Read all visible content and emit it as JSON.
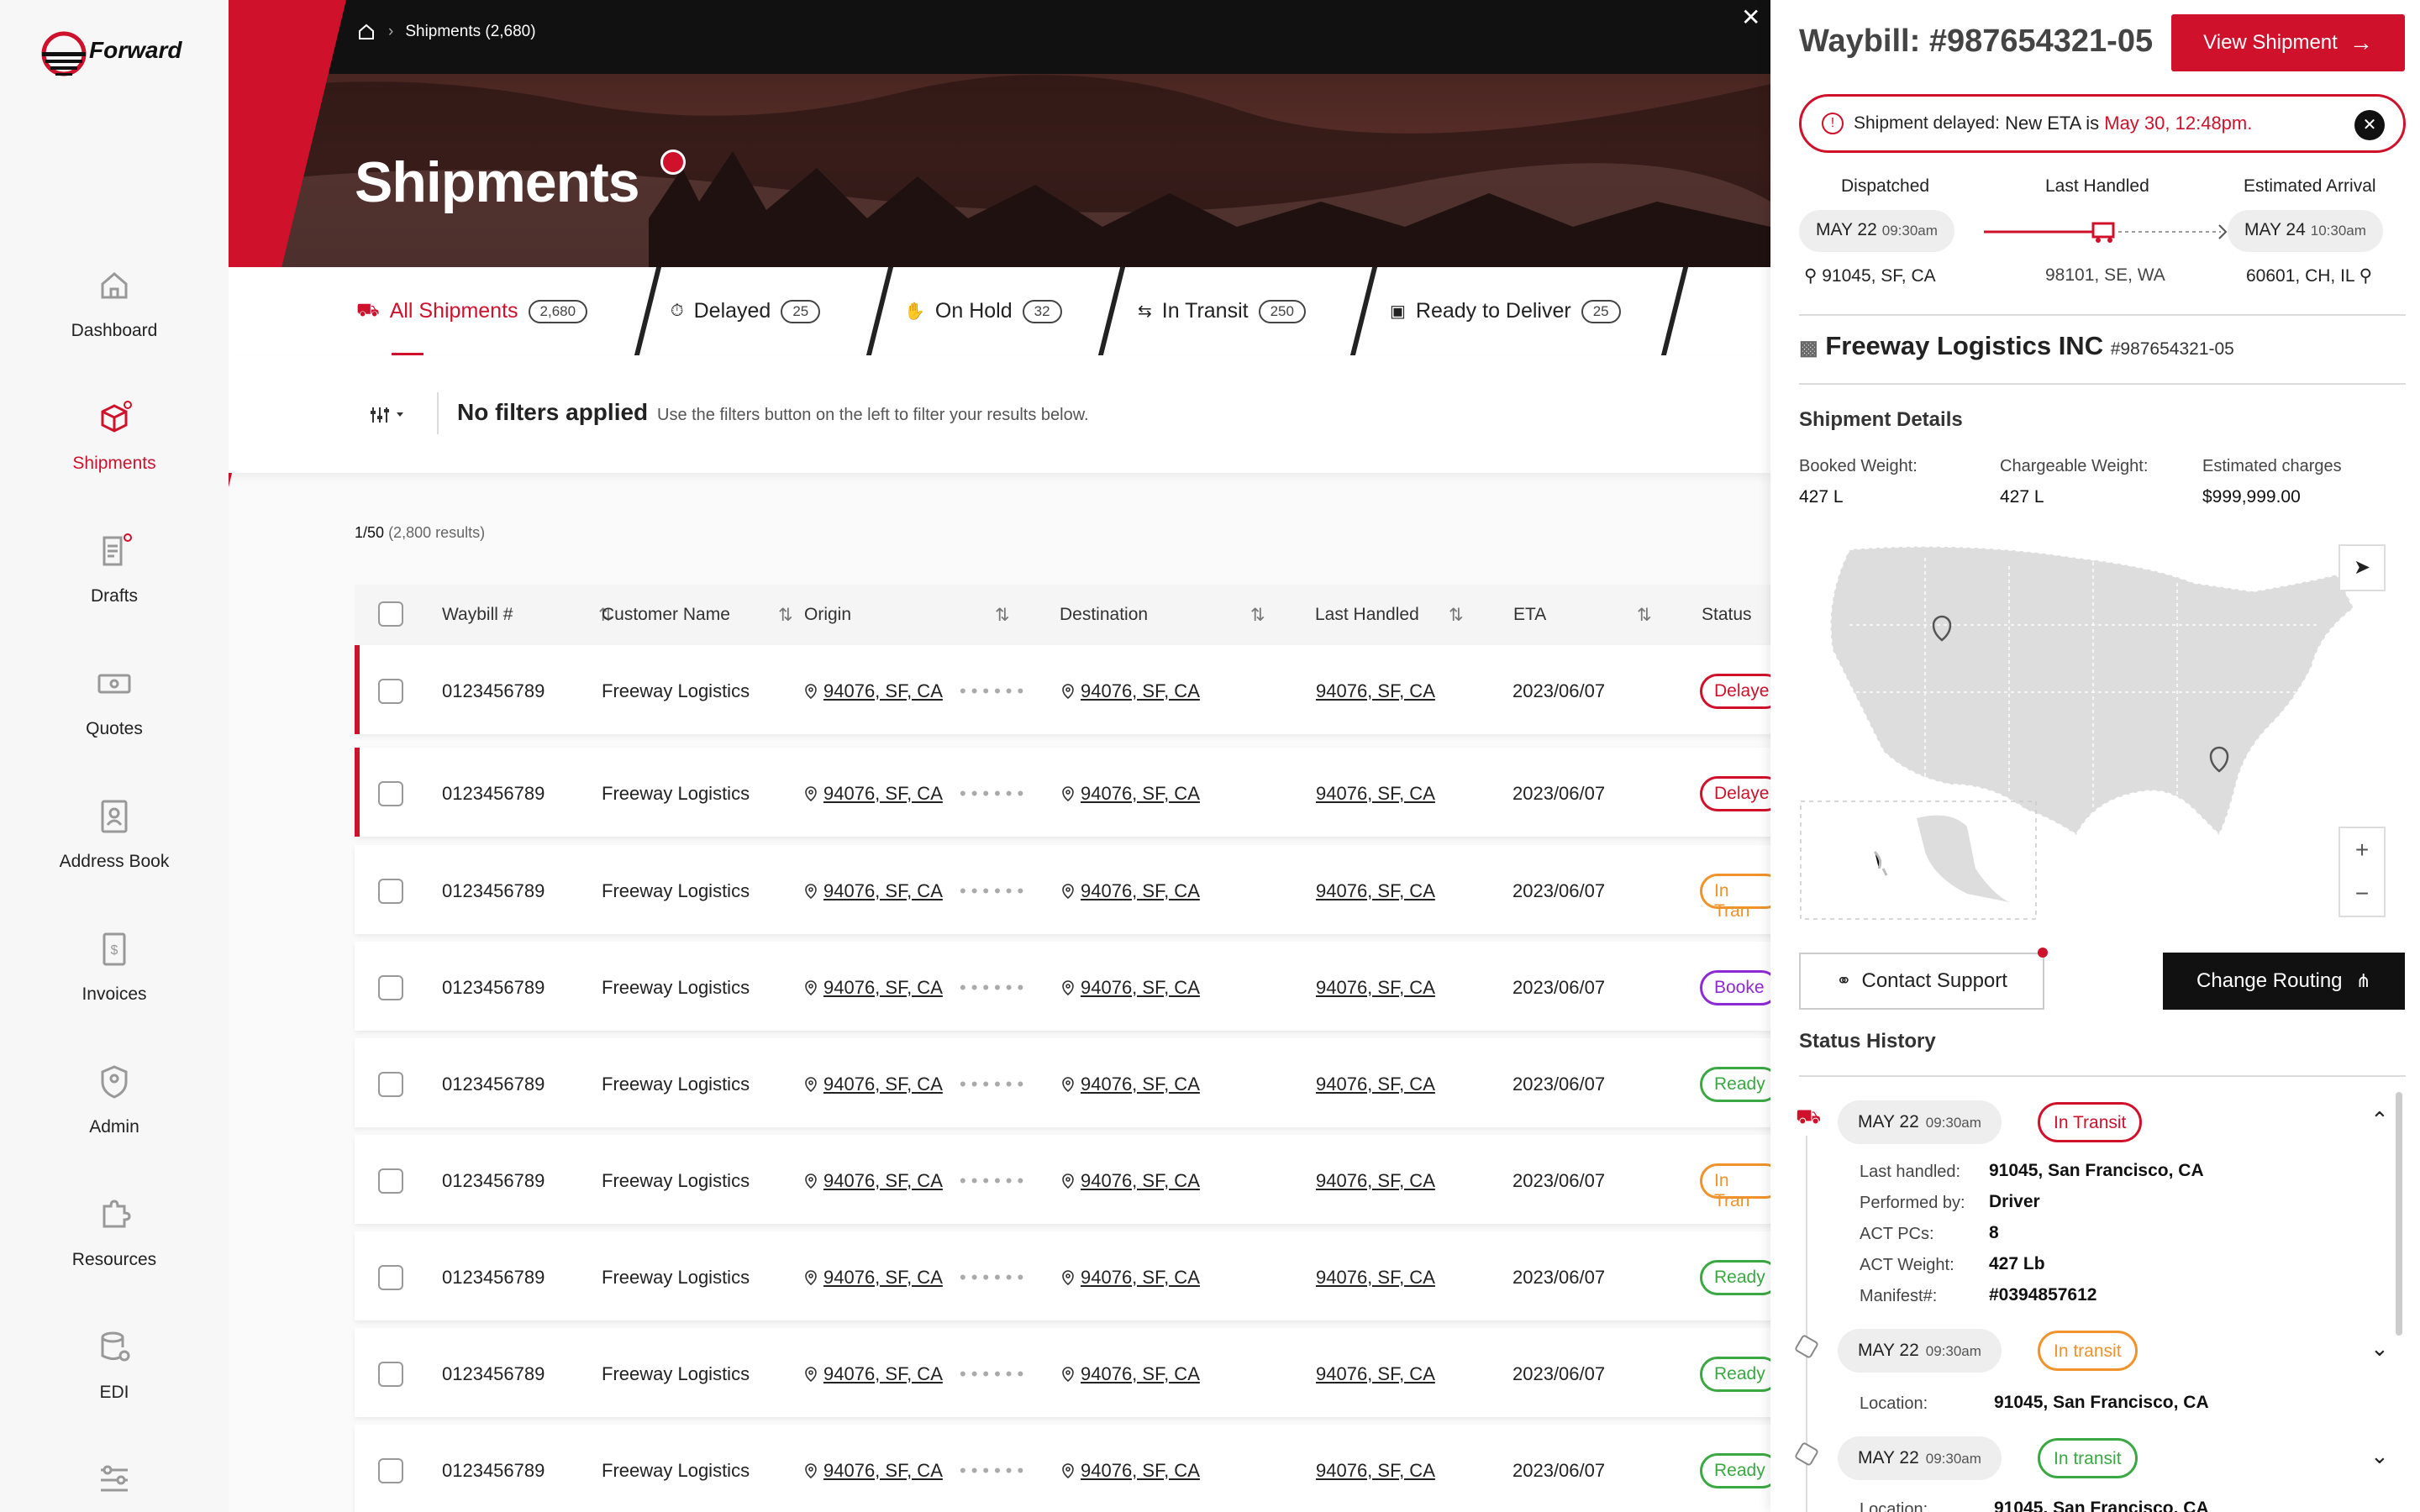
{
  "app": {
    "brand": "Forward"
  },
  "sidebar": {
    "items": [
      {
        "label": "Dashboard",
        "icon": "home-icon"
      },
      {
        "label": "Shipments",
        "icon": "box-icon",
        "active": true
      },
      {
        "label": "Drafts",
        "icon": "drafts-icon"
      },
      {
        "label": "Quotes",
        "icon": "money-icon"
      },
      {
        "label": "Address Book",
        "icon": "address-book-icon"
      },
      {
        "label": "Invoices",
        "icon": "invoice-icon"
      },
      {
        "label": "Admin",
        "icon": "shield-user-icon"
      },
      {
        "label": "Resources",
        "icon": "puzzle-icon"
      },
      {
        "label": "EDI",
        "icon": "database-gear-icon"
      }
    ]
  },
  "header": {
    "breadcrumb": "Shipments (2,680)",
    "title": "Shipments"
  },
  "tabs": [
    {
      "label": "All Shipments",
      "count": "2,680"
    },
    {
      "label": "Delayed",
      "count": "25"
    },
    {
      "label": "On Hold",
      "count": "32"
    },
    {
      "label": "In Transit",
      "count": "250"
    },
    {
      "label": "Ready to Deliver",
      "count": "25"
    }
  ],
  "filters": {
    "title": "No filters applied",
    "hint": "Use the filters button on the left to filter your results below."
  },
  "results": {
    "page": "1/50",
    "total": "(2,800 results)"
  },
  "table": {
    "headers": [
      "Waybill #",
      "Customer Name",
      "Origin",
      "Destination",
      "Last Handled",
      "ETA",
      "Status"
    ],
    "rows": [
      {
        "waybill": "0123456789",
        "customer": "Freeway Logistics",
        "origin": "94076, SF, CA",
        "destination": "94076, SF, CA",
        "last": "94076, SF, CA",
        "eta": "2023/06/07",
        "status": "Delaye"
      },
      {
        "waybill": "0123456789",
        "customer": "Freeway Logistics",
        "origin": "94076, SF, CA",
        "destination": "94076, SF, CA",
        "last": "94076, SF, CA",
        "eta": "2023/06/07",
        "status": "Delaye"
      },
      {
        "waybill": "0123456789",
        "customer": "Freeway Logistics",
        "origin": "94076, SF, CA",
        "destination": "94076, SF, CA",
        "last": "94076, SF, CA",
        "eta": "2023/06/07",
        "status": "In Tran"
      },
      {
        "waybill": "0123456789",
        "customer": "Freeway Logistics",
        "origin": "94076, SF, CA",
        "destination": "94076, SF, CA",
        "last": "94076, SF, CA",
        "eta": "2023/06/07",
        "status": "Booke"
      },
      {
        "waybill": "0123456789",
        "customer": "Freeway Logistics",
        "origin": "94076, SF, CA",
        "destination": "94076, SF, CA",
        "last": "94076, SF, CA",
        "eta": "2023/06/07",
        "status": "Ready"
      },
      {
        "waybill": "0123456789",
        "customer": "Freeway Logistics",
        "origin": "94076, SF, CA",
        "destination": "94076, SF, CA",
        "last": "94076, SF, CA",
        "eta": "2023/06/07",
        "status": "In Tran"
      },
      {
        "waybill": "0123456789",
        "customer": "Freeway Logistics",
        "origin": "94076, SF, CA",
        "destination": "94076, SF, CA",
        "last": "94076, SF, CA",
        "eta": "2023/06/07",
        "status": "Ready"
      },
      {
        "waybill": "0123456789",
        "customer": "Freeway Logistics",
        "origin": "94076, SF, CA",
        "destination": "94076, SF, CA",
        "last": "94076, SF, CA",
        "eta": "2023/06/07",
        "status": "Ready"
      },
      {
        "waybill": "0123456789",
        "customer": "Freeway Logistics",
        "origin": "94076, SF, CA",
        "destination": "94076, SF, CA",
        "last": "94076, SF, CA",
        "eta": "2023/06/07",
        "status": "Ready"
      }
    ]
  },
  "colors": {
    "brand": "#d0112b",
    "delayed": "#d0112b",
    "in_transit": "#f0932b",
    "booked": "#8e2ad6",
    "ready": "#3aa843"
  },
  "panel": {
    "waybill": "Waybill: #987654321-05",
    "view_button": "View Shipment",
    "alert": {
      "prefix": "Shipment delayed:",
      "middle": " New ETA is ",
      "eta": "May 30, 12:48pm."
    },
    "route": {
      "dispatched_label": "Dispatched",
      "last_label": "Last Handled",
      "arrival_label": "Estimated Arrival",
      "dispatched_date": "MAY 22",
      "dispatched_time": "09:30am",
      "arrival_date": "MAY 24",
      "arrival_time": "10:30am",
      "origin": "91045, SF, CA",
      "last": "98101, SE, WA",
      "destination": "60601, CH, IL"
    },
    "carrier": {
      "name": "Freeway Logistics INC",
      "ref": "#987654321-05"
    },
    "details": {
      "title": "Shipment Details",
      "booked_label": "Booked Weight:",
      "booked_value": "427 L",
      "chargeable_label": "Chargeable Weight:",
      "chargeable_value": "427 L",
      "charges_label": "Estimated charges",
      "charges_value": "$999,999.00"
    },
    "contact_button": "Contact Support",
    "routing_button": "Change Routing",
    "history": {
      "title": "Status History",
      "entries": [
        {
          "date": "MAY 22",
          "time": "09:30am",
          "status": "In Transit",
          "rows": [
            {
              "k": "Last handled:",
              "v": "91045, San Francisco, CA"
            },
            {
              "k": "Performed by:",
              "v": "Driver"
            },
            {
              "k": "ACT PCs:",
              "v": "8"
            },
            {
              "k": "ACT Weight:",
              "v": "427 Lb"
            },
            {
              "k": "Manifest#:",
              "v": "#0394857612"
            }
          ]
        },
        {
          "date": "MAY 22",
          "time": "09:30am",
          "status": "In transit",
          "location_label": "Location:",
          "location": "91045, San Francisco, CA"
        },
        {
          "date": "MAY 22",
          "time": "09:30am",
          "status": "In transit",
          "location_label": "Location:",
          "location": "91045, San Francisco, CA"
        }
      ]
    }
  }
}
